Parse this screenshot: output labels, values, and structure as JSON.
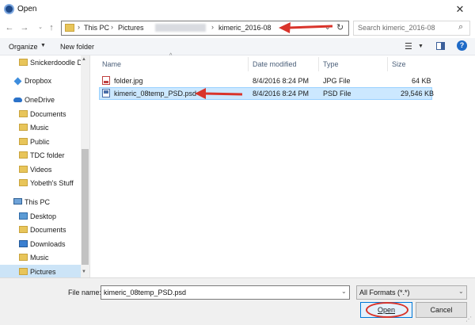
{
  "window": {
    "title": "Open"
  },
  "address": {
    "crumbs": [
      "This PC",
      "Pictures",
      "kimeric_2016-08"
    ],
    "search_placeholder": "Search kimeric_2016-08"
  },
  "toolbar": {
    "organize": "Organize",
    "new_folder": "New folder"
  },
  "nav": {
    "items": [
      {
        "label": "Snickerdoodle D",
        "icon": "folder-icon"
      },
      {
        "label": "Dropbox",
        "icon": "dropbox-icon"
      },
      {
        "label": "OneDrive",
        "icon": "cloud-icon"
      },
      {
        "label": "Documents",
        "icon": "folder-icon"
      },
      {
        "label": "Music",
        "icon": "folder-icon"
      },
      {
        "label": "Public",
        "icon": "folder-icon"
      },
      {
        "label": "TDC folder",
        "icon": "folder-icon"
      },
      {
        "label": "Videos",
        "icon": "folder-icon"
      },
      {
        "label": "Yobeth's Stuff",
        "icon": "folder-icon"
      },
      {
        "label": "This PC",
        "icon": "computer-icon"
      },
      {
        "label": "Desktop",
        "icon": "folder-icon"
      },
      {
        "label": "Documents",
        "icon": "folder-icon"
      },
      {
        "label": "Downloads",
        "icon": "folder-icon"
      },
      {
        "label": "Music",
        "icon": "folder-icon"
      },
      {
        "label": "Pictures",
        "icon": "folder-icon",
        "selected": true
      }
    ]
  },
  "columns": {
    "name": "Name",
    "date": "Date modified",
    "type": "Type",
    "size": "Size"
  },
  "files": [
    {
      "name": "folder.jpg",
      "date": "8/4/2016 8:24 PM",
      "type": "JPG File",
      "size": "64 KB"
    },
    {
      "name": "kimeric_08temp_PSD.psd",
      "date": "8/4/2016 8:24 PM",
      "type": "PSD File",
      "size": "29,546 KB",
      "selected": true
    }
  ],
  "bottom": {
    "file_name_label": "File name:",
    "file_name_value": "kimeric_08temp_PSD.psd",
    "filter_value": "All Formats (*.*)",
    "open_label": "Open",
    "cancel_label": "Cancel"
  },
  "colors": {
    "accent": "#0078d7",
    "selection": "#cce8ff",
    "annotation_red": "#d9342b"
  }
}
